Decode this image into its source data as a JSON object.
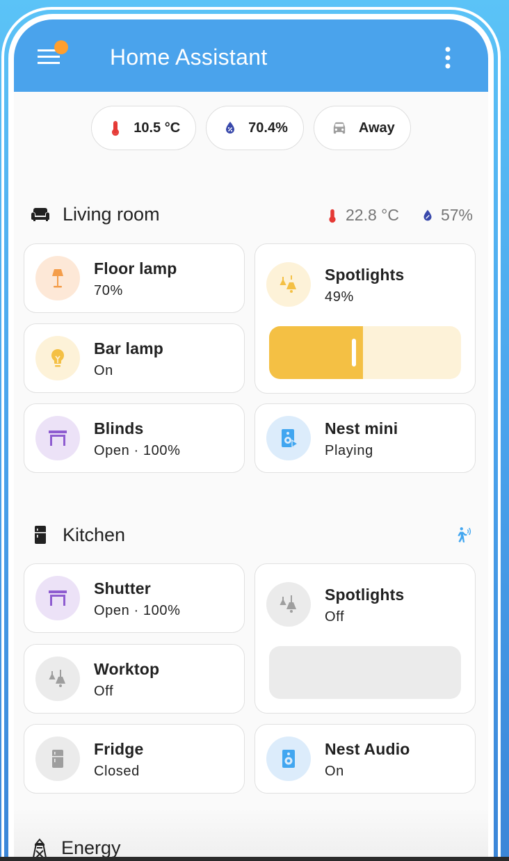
{
  "app_title": "Home Assistant",
  "colors": {
    "accent": "#4aa3ec",
    "notification": "#ff9f2e",
    "thermo": "#e53935",
    "humidity": "#3949ab",
    "lamp_orange": "#f49d4a",
    "lamp_yellow": "#f4c044",
    "cover_purple": "#8e5cd0",
    "media_blue": "#41a6f0",
    "off_gray": "#9e9e9e"
  },
  "badges": [
    {
      "icon": "thermometer-icon",
      "value": "10.5 °C"
    },
    {
      "icon": "water-percent-icon",
      "value": "70.4%"
    },
    {
      "icon": "car-icon",
      "value": "Away"
    }
  ],
  "living_room": {
    "title": "Living room",
    "icon": "sofa-icon",
    "temperature": "22.8 °C",
    "humidity": "57%",
    "cards": {
      "floor_lamp": {
        "name": "Floor lamp",
        "state": "70%",
        "icon": "floor-lamp-icon"
      },
      "spotlights": {
        "name": "Spotlights",
        "state": "49%",
        "icon": "ceiling-light-multiple-icon",
        "brightness": 0.49
      },
      "bar_lamp": {
        "name": "Bar lamp",
        "state": "On",
        "icon": "lightbulb-icon"
      },
      "blinds": {
        "name": "Blinds",
        "state": "Open · 100%",
        "icon": "window-shutter-open-icon"
      },
      "nest_mini": {
        "name": "Nest mini",
        "state": "Playing",
        "icon": "speaker-play-icon"
      }
    }
  },
  "kitchen": {
    "title": "Kitchen",
    "icon": "fridge-icon",
    "cards": {
      "shutter": {
        "name": "Shutter",
        "state": "Open · 100%",
        "icon": "window-shutter-open-icon"
      },
      "spotlights": {
        "name": "Spotlights",
        "state": "Off",
        "icon": "ceiling-light-multiple-icon",
        "brightness": 0
      },
      "worktop": {
        "name": "Worktop",
        "state": "Off",
        "icon": "ceiling-light-multiple-icon"
      },
      "fridge": {
        "name": "Fridge",
        "state": "Closed",
        "icon": "fridge-icon"
      },
      "nest_audio": {
        "name": "Nest Audio",
        "state": "On",
        "icon": "speaker-icon"
      }
    }
  },
  "energy": {
    "title": "Energy",
    "icon": "transmission-tower-icon"
  }
}
